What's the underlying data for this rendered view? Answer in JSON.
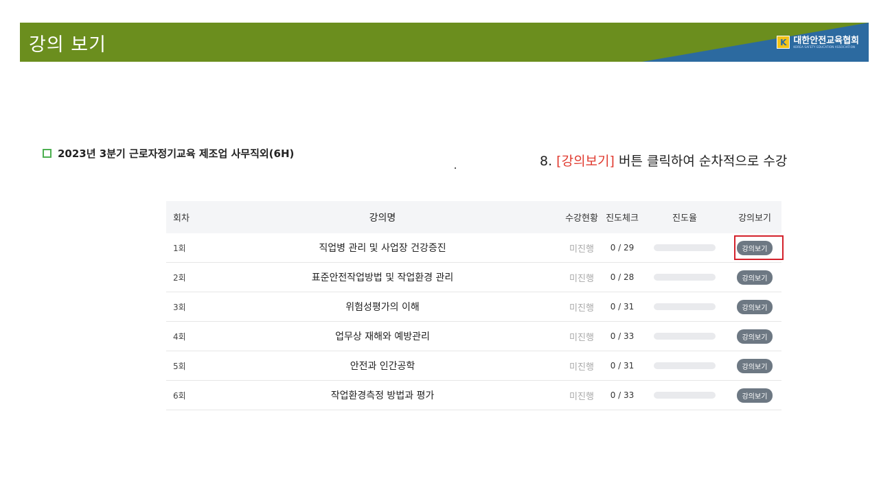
{
  "header": {
    "title": "강의 보기",
    "brand_logo": "K",
    "brand_name": "대한안전교육협회",
    "brand_sub": "KOREA SAFETY EDUCATION ASSOCIATION"
  },
  "course": {
    "title": "2023년 3분기 근로자정기교육 제조업 사무직외(6H)"
  },
  "instruction": {
    "prefix": "8. ",
    "highlight": "[강의보기]",
    "suffix": " 버튼 클릭하여 순차적으로 수강"
  },
  "table": {
    "headers": {
      "no": "회차",
      "name": "강의명",
      "status": "수강현황",
      "check": "진도체크",
      "rate": "진도율",
      "view": "강의보기"
    },
    "rows": [
      {
        "no": "1회",
        "name": "직업병 관리 및 사업장 건강증진",
        "status": "미진행",
        "check": "0 / 29",
        "progress": 0,
        "button": "강의보기"
      },
      {
        "no": "2회",
        "name": "표준안전작업방법 및 작업환경 관리",
        "status": "미진행",
        "check": "0 / 28",
        "progress": 0,
        "button": "강의보기"
      },
      {
        "no": "3회",
        "name": "위험성평가의 이해",
        "status": "미진행",
        "check": "0 / 31",
        "progress": 0,
        "button": "강의보기"
      },
      {
        "no": "4회",
        "name": "업무상 재해와 예방관리",
        "status": "미진행",
        "check": "0 / 33",
        "progress": 0,
        "button": "강의보기"
      },
      {
        "no": "5회",
        "name": "안전과 인간공학",
        "status": "미진행",
        "check": "0 / 31",
        "progress": 0,
        "button": "강의보기"
      },
      {
        "no": "6회",
        "name": "작업환경측정 방법과 평가",
        "status": "미진행",
        "check": "0 / 33",
        "progress": 0,
        "button": "강의보기"
      }
    ]
  },
  "colors": {
    "banner_green": "#6b8e1e",
    "banner_blue": "#2c6aa0",
    "highlight_red": "#d3202a",
    "button_gray": "#6d7883"
  }
}
